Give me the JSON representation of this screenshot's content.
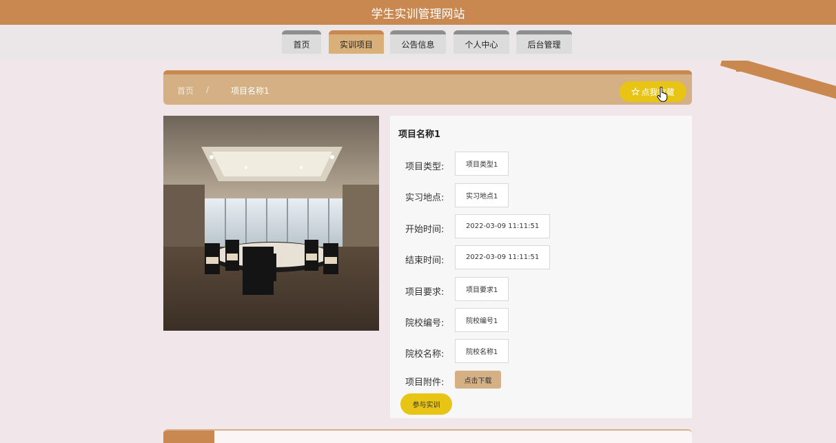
{
  "site": {
    "title": "学生实训管理网站"
  },
  "nav": {
    "items": [
      {
        "label": "首页",
        "active": false
      },
      {
        "label": "实训项目",
        "active": true
      },
      {
        "label": "公告信息",
        "active": false
      },
      {
        "label": "个人中心",
        "active": false
      },
      {
        "label": "后台管理",
        "active": false
      }
    ]
  },
  "breadcrumb": {
    "home": "首页",
    "separator": "/",
    "current": "项目名称1",
    "favorite_label": "点我收藏",
    "favorite_icon": "star-icon"
  },
  "detail": {
    "title": "项目名称1",
    "fields": [
      {
        "label": "项目类型:",
        "value": "项目类型1"
      },
      {
        "label": "实习地点:",
        "value": "实习地点1"
      },
      {
        "label": "开始时间:",
        "value": "2022-03-09 11:11:51"
      },
      {
        "label": "结束时间:",
        "value": "2022-03-09 11:11:51"
      },
      {
        "label": "项目要求:",
        "value": "项目要求1"
      },
      {
        "label": "院校编号:",
        "value": "院校编号1"
      },
      {
        "label": "院校名称:",
        "value": "院校名称1"
      }
    ],
    "attachment_label": "项目附件:",
    "download_label": "点击下载",
    "join_label": "参与实训"
  },
  "colors": {
    "brand": "#c8884f",
    "accent_yellow": "#e8c414",
    "breadcrumb_bg": "#d4b084",
    "page_bg": "#f1e7ea"
  }
}
